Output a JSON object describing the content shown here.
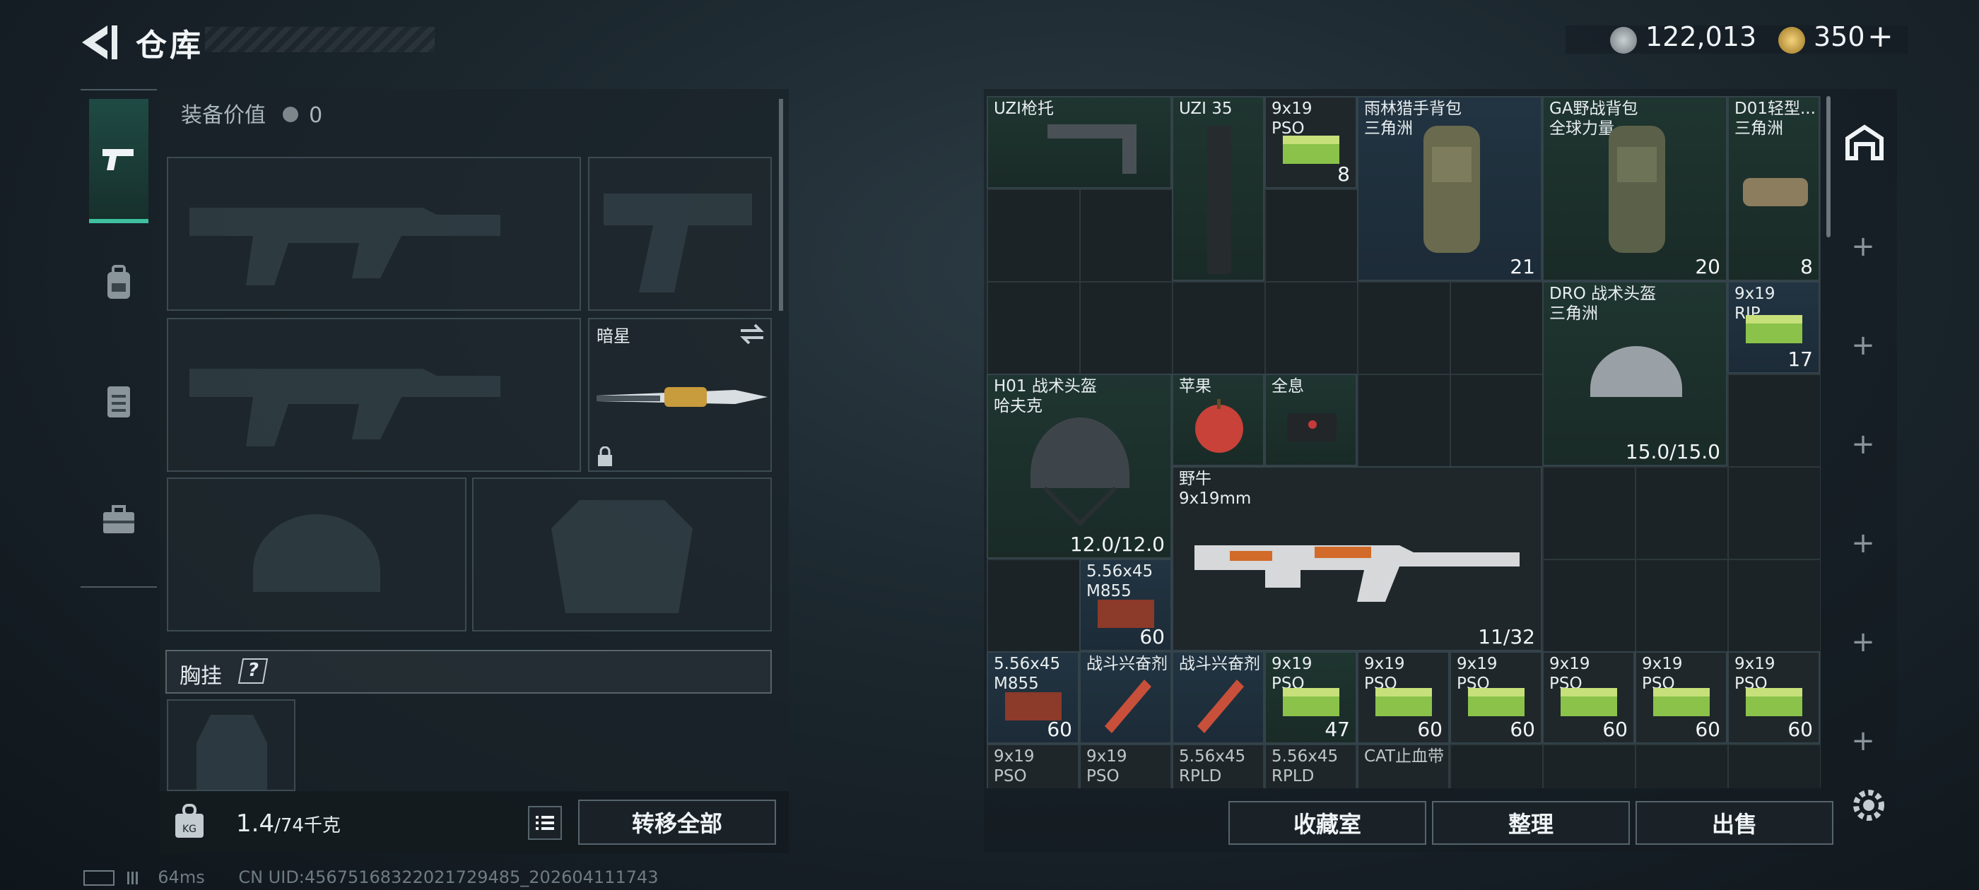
{
  "header": {
    "title": "仓库",
    "currency_1": "122,013",
    "currency_2": "350",
    "currency_2_add": "+"
  },
  "equipment": {
    "value_label": "装备价值",
    "value": "0",
    "melee_name": "暗星",
    "chest_label": "胸挂",
    "help": "?"
  },
  "bottom_left": {
    "weight": "1.4",
    "weight_max": "/74千克",
    "transfer_all": "转移全部"
  },
  "items": [
    {
      "name": "UZI枪托",
      "count": ""
    },
    {
      "name": "UZI 35",
      "count": ""
    },
    {
      "name": "9x19\nPSO",
      "count": "8"
    },
    {
      "name": "雨林猎手背包\n三角洲",
      "count": "21"
    },
    {
      "name": "GA野战背包\n全球力量",
      "count": "20"
    },
    {
      "name": "D01轻型...\n三角洲",
      "count": "8"
    },
    {
      "name": "DRO 战术头盔\n三角洲",
      "count": "15.0/15.0"
    },
    {
      "name": "9x19\nRIP",
      "count": "17"
    },
    {
      "name": "H01 战术头盔\n哈夫克",
      "count": "12.0/12.0"
    },
    {
      "name": "苹果",
      "count": ""
    },
    {
      "name": "全息",
      "count": ""
    },
    {
      "name": "野牛\n9x19mm",
      "count": "11/32"
    },
    {
      "name": "5.56x45\nM855",
      "count": "60"
    },
    {
      "name": "5.56x45\nM855",
      "count": "60"
    },
    {
      "name": "战斗兴奋剂",
      "count": ""
    },
    {
      "name": "战斗兴奋剂",
      "count": ""
    },
    {
      "name": "9x19\nPSO",
      "count": "47"
    },
    {
      "name": "9x19\nPSO",
      "count": "60"
    },
    {
      "name": "9x19\nPSO",
      "count": "60"
    },
    {
      "name": "9x19\nPSO",
      "count": "60"
    },
    {
      "name": "9x19\nPSO",
      "count": "60"
    },
    {
      "name": "9x19\nPSO",
      "count": "60"
    },
    {
      "name": "9x19\nPSO",
      "count": ""
    },
    {
      "name": "9x19\nPSO",
      "count": ""
    },
    {
      "name": "5.56x45\nRPLD",
      "count": ""
    },
    {
      "name": "5.56x45\nRPLD",
      "count": ""
    },
    {
      "name": "CAT止血带",
      "count": ""
    }
  ],
  "actions": {
    "collection": "收藏室",
    "sort": "整理",
    "sell": "出售"
  },
  "footer": {
    "ping": "64ms",
    "uid": "CN UID:4567516832202172948​5_202604111743"
  }
}
